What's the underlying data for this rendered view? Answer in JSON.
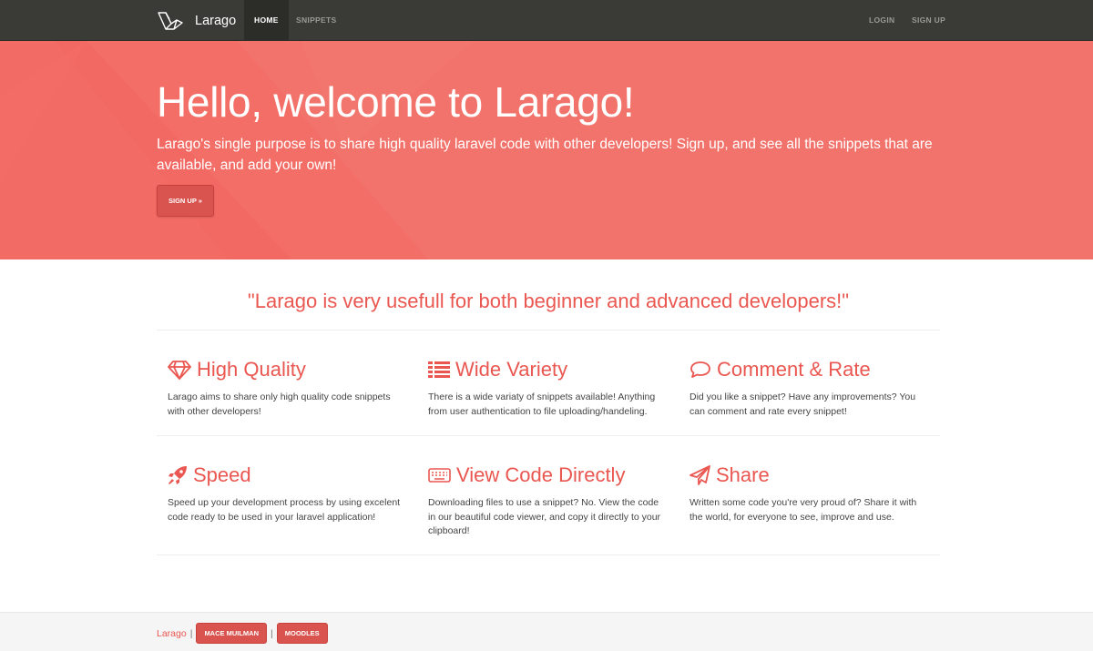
{
  "navbar": {
    "brand": "Larago",
    "items": [
      {
        "label": "HOME",
        "active": true
      },
      {
        "label": "SNIPPETS",
        "active": false
      }
    ],
    "right_items": [
      {
        "label": "LOGIN"
      },
      {
        "label": "SIGN UP"
      }
    ]
  },
  "hero": {
    "title": "Hello, welcome to Larago!",
    "text": "Larago's single purpose is to share high quality laravel code with other developers! Sign up, and see all the snippets that are available, and add your own!",
    "button": "SIGN UP »"
  },
  "quote": "\"Larago is very usefull for both beginner and advanced developers!\"",
  "features": [
    {
      "icon": "diamond-icon",
      "title": "High Quality",
      "text": "Larago aims to share only high quality code snippets with other developers!"
    },
    {
      "icon": "list-icon",
      "title": "Wide Variety",
      "text": "There is a wide variaty of snippets available! Anything from user authentication to file uploading/handeling."
    },
    {
      "icon": "comment-icon",
      "title": "Comment & Rate",
      "text": "Did you like a snippet? Have any improvements? You can comment and rate every snippet!"
    },
    {
      "icon": "rocket-icon",
      "title": "Speed",
      "text": "Speed up your development process by using excelent code ready to be used in your laravel application!"
    },
    {
      "icon": "keyboard-icon",
      "title": "View Code Directly",
      "text": "Downloading files to use a snippet? No. View the code in our beautiful code viewer, and copy it directly to your clipboard!"
    },
    {
      "icon": "paper-plane-icon",
      "title": "Share",
      "text": "Written some code you're very proud of? Share it with the world, for everyone to see, improve and use."
    }
  ],
  "footer": {
    "brand": "Larago",
    "separator": "|",
    "buttons": [
      "MACE MUILMAN",
      "MOODLES"
    ]
  },
  "colors": {
    "accent": "#ea5650",
    "hero_bg": "#f2736b",
    "navbar_bg": "#3a3a36",
    "button_bg": "#d9534f"
  }
}
